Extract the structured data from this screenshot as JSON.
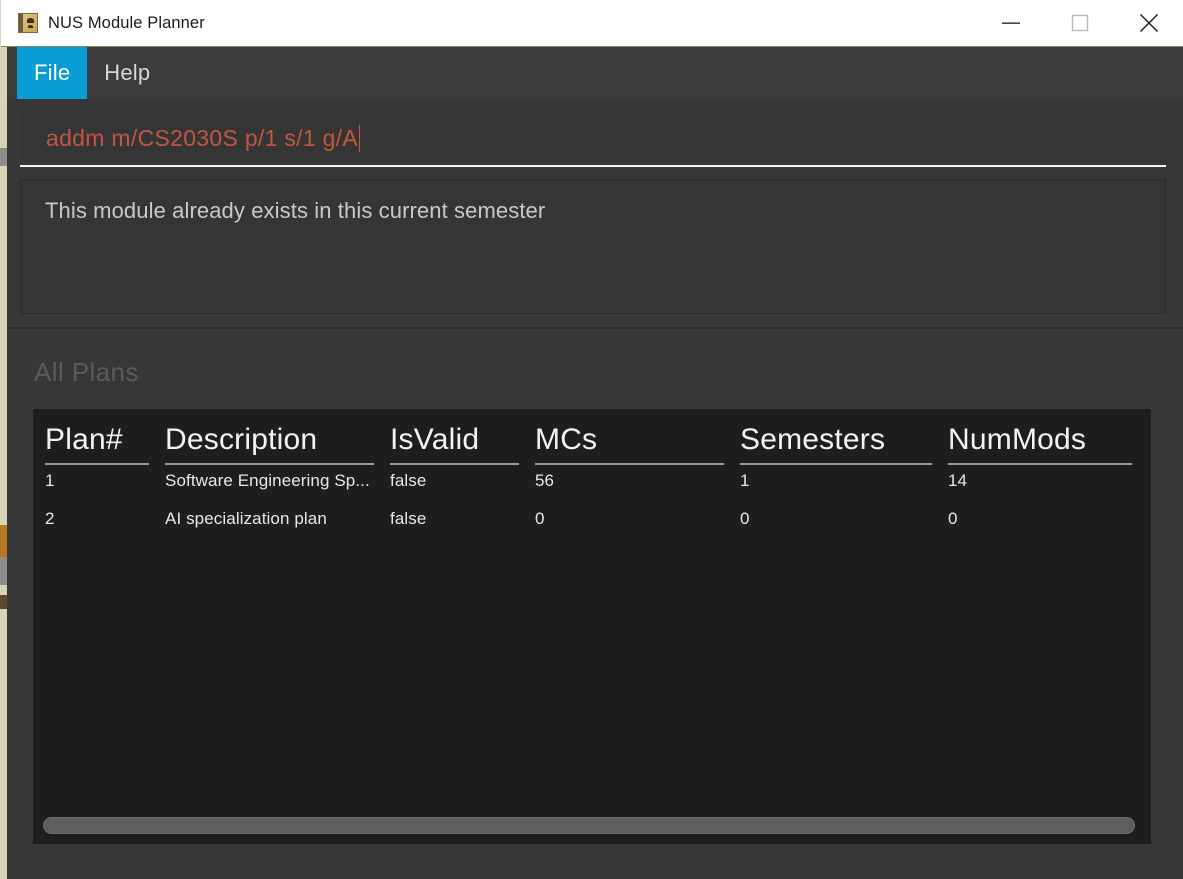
{
  "window": {
    "title": "NUS Module Planner",
    "icon": "java-duke-app-icon",
    "controls": {
      "minimize": "minimize-icon",
      "maximize": "maximize-icon",
      "close": "close-icon"
    }
  },
  "menu": {
    "items": [
      {
        "label": "File",
        "active": true
      },
      {
        "label": "Help",
        "active": false
      }
    ]
  },
  "command": {
    "value": "addm m/CS2030S p/1 s/1 g/A",
    "placeholder": "Enter command here...",
    "text_color": "#c1573f"
  },
  "feedback": {
    "message": "This module already exists in this current semester"
  },
  "plans_panel": {
    "title": "All Plans",
    "table": {
      "columns": [
        "Plan#",
        "Description",
        "IsValid",
        "MCs",
        "Semesters",
        "NumMods"
      ],
      "rows": [
        {
          "plan": "1",
          "description": "Software Engineering Sp...",
          "isvalid": "false",
          "mcs": "56",
          "semesters": "1",
          "nummods": "14"
        },
        {
          "plan": "2",
          "description": "AI specialization plan",
          "isvalid": "false",
          "mcs": "0",
          "semesters": "0",
          "nummods": "0"
        }
      ],
      "hscrollbar": "horizontal-scrollbar"
    }
  },
  "theme": {
    "accent_blue": "#0a9cd4",
    "app_bg": "#373737",
    "panel_bg": "#1e1e1e",
    "error_text": "#c1573f",
    "frame_strip": "#d8d2b8"
  }
}
